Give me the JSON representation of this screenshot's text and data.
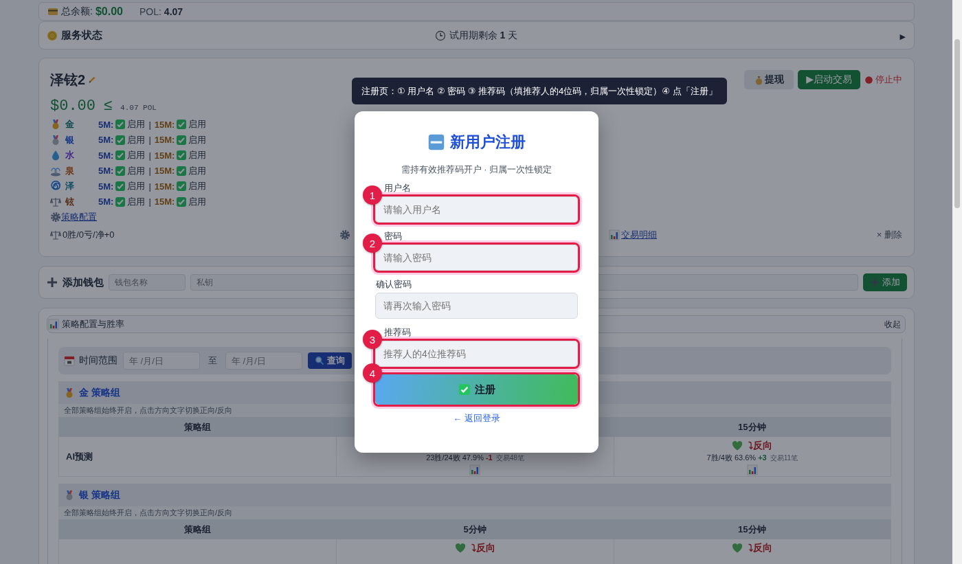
{
  "balance_bar": {
    "label": "总余额:",
    "amount": "$0.00",
    "pol_label": "POL:",
    "pol_value": "4.07"
  },
  "service_status": {
    "title": "服务状态",
    "trial": "试用期剩余 **1** 天",
    "toggle": "▶"
  },
  "wallet": {
    "name": "泽铉2",
    "balance": "$0.00",
    "relation": "≤",
    "pol": "4.07 POL",
    "withdraw": "提现",
    "start": "▶启动交易",
    "status": "停止中",
    "running": false,
    "strategies": [
      {
        "name": "金",
        "color": "#104c4e",
        "m5_label": "5M:",
        "m5_enabled": true,
        "m5_text": "启用",
        "separator": "|",
        "m15_label": "15M:",
        "m15_enabled": true,
        "m15_text": "启用"
      },
      {
        "name": "银",
        "color": "#183688",
        "m5_label": "5M:",
        "m5_enabled": true,
        "m5_text": "启用",
        "separator": "|",
        "m15_label": "15M:",
        "m15_enabled": true,
        "m15_text": "启用"
      },
      {
        "name": "水",
        "color": "#442189",
        "m5_label": "5M:",
        "m5_enabled": true,
        "m5_text": "启用",
        "separator": "|",
        "m15_label": "15M:",
        "m15_enabled": true,
        "m15_text": "启用"
      },
      {
        "name": "泉",
        "color": "#6b3816",
        "m5_label": "5M:",
        "m5_enabled": true,
        "m5_text": "启用",
        "separator": "|",
        "m15_label": "15M:",
        "m15_enabled": true,
        "m15_text": "启用"
      },
      {
        "name": "泽",
        "color": "#0f4b61",
        "m5_label": "5M:",
        "m5_enabled": true,
        "m5_text": "启用",
        "separator": "|",
        "m15_label": "15M:",
        "m15_enabled": true,
        "m15_text": "启用"
      },
      {
        "name": "铉",
        "color": "#582e19",
        "m5_label": "5M:",
        "m5_enabled": true,
        "m5_text": "启用",
        "separator": "|",
        "m15_label": "15M:",
        "m15_enabled": true,
        "m15_text": "启用"
      }
    ],
    "config_link": "策略配置",
    "record": "0胜/0亏/净+0",
    "details_link": "交易明细",
    "delete": "× 删除"
  },
  "add_wallet": {
    "title": "添加钱包",
    "name_placeholder": "钱包名称",
    "key_placeholder": "私钥",
    "button": "添加"
  },
  "strategy_panel": {
    "title": "策略配置与胜率",
    "collapse": "收起",
    "time_range": {
      "label": "时间范围",
      "start_placeholder": "年 /月/日",
      "to": "至",
      "end_placeholder": "年 /月/日",
      "query": "查询"
    },
    "groups": [
      {
        "title": "金 策略组",
        "note": "全部策略组始终开启，点击方向文字切换正向/反向",
        "columns": [
          {
            "label": "策略组"
          },
          {},
          {
            "label": "15分钟"
          }
        ],
        "rows": [
          {
            "cells": [
              {
                "name": "AI预测"
              },
              {
                "stats": "23胜/24败 47.9%",
                "delta": "-1",
                "gain": false,
                "trades": "交易48笔"
              },
              {
                "direction": "⤵反向",
                "stats": "7胜/4败 63.6%",
                "delta": "+3",
                "gain": true,
                "trades": "交易11笔"
              }
            ]
          }
        ]
      },
      {
        "title": "银 策略组",
        "note": "全部策略组始终开启，点击方向文字切换正向/反向",
        "columns": [
          {
            "label": "策略组"
          },
          {
            "label": "5分钟"
          },
          {
            "label": "15分钟"
          }
        ],
        "rows": [
          {
            "cells": [
              {},
              {
                "direction": "⤵反向"
              },
              {
                "direction": "⤵反向"
              }
            ]
          }
        ]
      }
    ]
  },
  "modal": {
    "tooltip": "注册页：① 用户名 ② 密码 ③ 推荐码（填推荐人的4位码，归属一次性锁定）④ 点「注册」",
    "title": "新用户注册",
    "subtitle": "需持有效推荐码开户 · 归属一次性锁定",
    "fields": [
      {
        "label": "用户名",
        "placeholder": "请输入用户名",
        "step": "1"
      },
      {
        "label": "密码",
        "placeholder": "请输入密码",
        "step": "2"
      },
      {
        "label": "确认密码",
        "placeholder": "请再次输入密码"
      },
      {
        "label": "推荐码",
        "placeholder": "推荐人的4位推荐码",
        "step": "3"
      }
    ],
    "submit": {
      "label": "注册",
      "step": "4"
    },
    "back_link": "← 返回登录"
  }
}
